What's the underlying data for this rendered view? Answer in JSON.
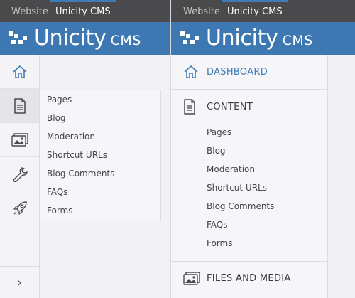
{
  "left": {
    "nav_tabs": [
      {
        "label": "Website"
      },
      {
        "label": "Unicity CMS",
        "active": true
      }
    ],
    "brand": {
      "name": "Unicity",
      "suffix": "CMS"
    },
    "rail_icons": [
      "home-icon",
      "document-icon",
      "images-icon",
      "wrench-icon",
      "rocket-icon"
    ],
    "flyout_items": [
      "Pages",
      "Blog",
      "Moderation",
      "Shortcut URLs",
      "Blog Comments",
      "FAQs",
      "Forms"
    ],
    "toggle_glyph": "›"
  },
  "right": {
    "nav_tabs": [
      {
        "label": "Website"
      },
      {
        "label": "Unicity CMS",
        "active": true
      }
    ],
    "brand": {
      "name": "Unicity",
      "suffix": "CMS"
    },
    "dashboard_label": "DASHBOARD",
    "content_label": "CONTENT",
    "content_items": [
      "Pages",
      "Blog",
      "Moderation",
      "Shortcut URLs",
      "Blog Comments",
      "FAQs",
      "Forms"
    ],
    "files_label": "FILES AND MEDIA"
  },
  "colors": {
    "topbar": "#4a4a4c",
    "brand_bar": "#3d78b3",
    "accent": "#3f7bb5",
    "sidebar_bg": "#f6f6f8"
  }
}
